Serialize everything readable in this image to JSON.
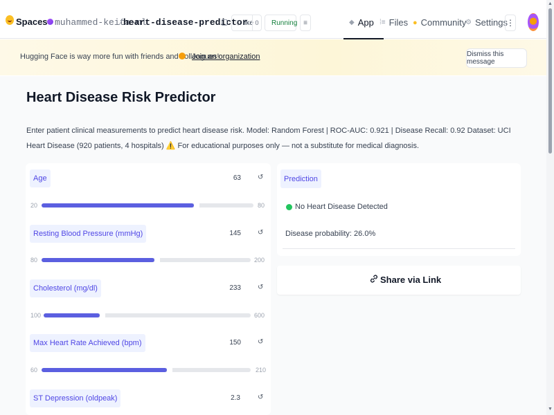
{
  "nav": {
    "brand": "Spaces",
    "owner": "muhammed-keita-ml",
    "separator": "/",
    "repo": "heart-disease-predictor",
    "like_label": "like",
    "like_count": "0",
    "status": "Running",
    "tabs": [
      {
        "label": "App",
        "icon": "app-icon"
      },
      {
        "label": "Files",
        "icon": "files-icon"
      },
      {
        "label": "Community",
        "icon": "community-icon"
      },
      {
        "label": "Settings",
        "icon": "gear-icon"
      }
    ],
    "more": "⋮"
  },
  "banner": {
    "text": "Hugging Face is way more fun with friends and colleagues!",
    "link": "Join an organization",
    "dismiss": "Dismiss this message"
  },
  "main": {
    "title": "Heart Disease Risk Predictor",
    "description": "Enter patient clinical measurements to predict heart disease risk. Model: Random Forest | ROC-AUC: 0.921 | Disease Recall: 0.92 Dataset: UCI Heart Disease (920 patients, 4 hospitals) ⚠️ For educational purposes only — not a substitute for medical diagnosis."
  },
  "fields": [
    {
      "label": "Age",
      "value": "63",
      "min": "20",
      "max": "80",
      "fraction": 0.72
    },
    {
      "label": "Resting Blood Pressure (mmHg)",
      "value": "145",
      "min": "80",
      "max": "200",
      "fraction": 0.54
    },
    {
      "label": "Cholesterol (mg/dl)",
      "value": "233",
      "min": "100",
      "max": "600",
      "fraction": 0.27
    },
    {
      "label": "Max Heart Rate Achieved (bpm)",
      "value": "150",
      "min": "60",
      "max": "210",
      "fraction": 0.6
    },
    {
      "label": "ST Depression (oldpeak)",
      "value": "2.3"
    }
  ],
  "prediction": {
    "label": "Prediction",
    "result": "No Heart Disease Detected",
    "probability": "Disease probability: 26.0%"
  },
  "share": {
    "label": "Share via Link"
  }
}
